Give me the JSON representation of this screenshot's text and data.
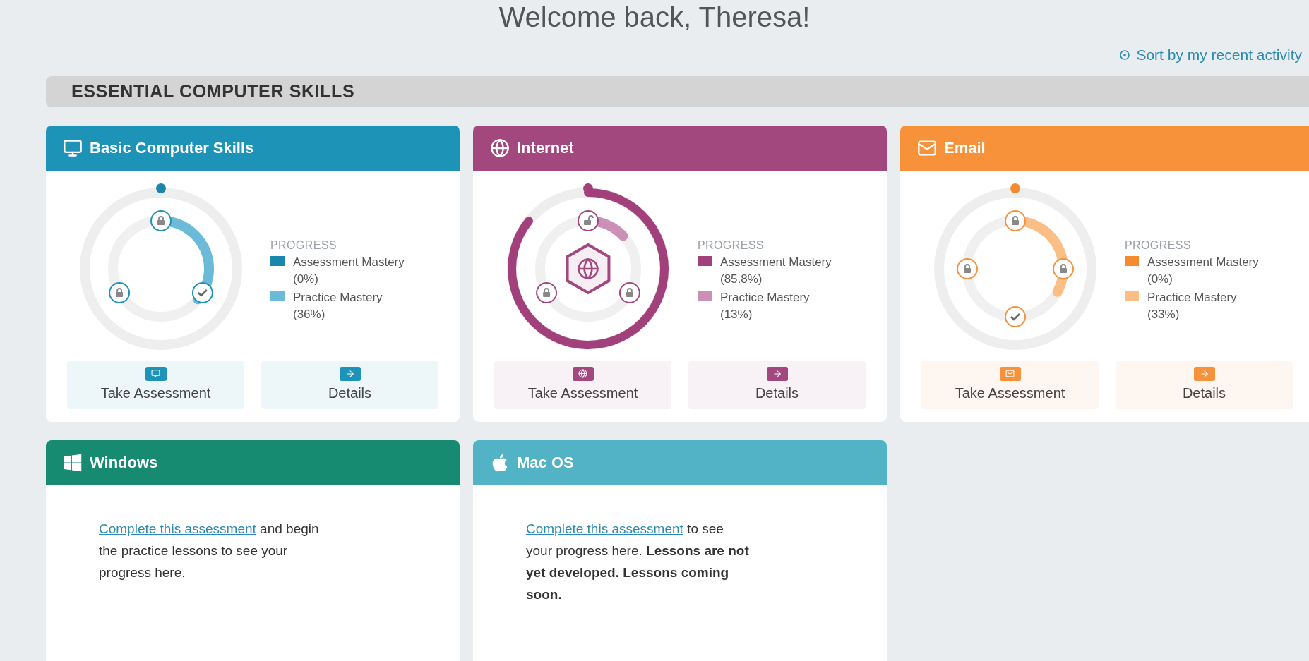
{
  "heading": "Welcome back, Theresa!",
  "sort_link": "Sort by my recent activity",
  "section": {
    "title": "ESSENTIAL COMPUTER SKILLS",
    "cards": [
      {
        "kind": "progress",
        "title": "Basic Computer Skills",
        "color": "#1e93b8",
        "badge": false,
        "legend_title": "PROGRESS",
        "milestones": [
          {
            "locked": true,
            "done": false
          },
          {
            "done": true
          },
          {
            "locked": true,
            "done": false
          }
        ],
        "legend": [
          {
            "label": "Assessment Mastery",
            "reading": "(0%)",
            "color": "#1a86ab"
          },
          {
            "label": "Practice Mastery",
            "reading": "(36%)",
            "color": "#6bbad7"
          }
        ],
        "buttons": [
          "Take Assessment",
          "Details"
        ]
      },
      {
        "kind": "progress",
        "title": "Internet",
        "color": "#a2487f",
        "badge": true,
        "legend_title": "PROGRESS",
        "milestones": [
          {
            "locked": false,
            "done": false
          },
          {
            "locked": true,
            "done": false
          },
          {
            "locked": true,
            "done": false
          }
        ],
        "legend": [
          {
            "label": "Assessment Mastery",
            "reading": "(85.8%)",
            "color": "#a2407c"
          },
          {
            "label": "Practice Mastery",
            "reading": "(13%)",
            "color": "#cc8fb5"
          }
        ],
        "buttons": [
          "Take Assessment",
          "Details"
        ]
      },
      {
        "kind": "progress",
        "title": "Email",
        "color": "#f7923a",
        "badge": false,
        "legend_title": "PROGRESS",
        "milestones": [
          {
            "locked": true,
            "done": false
          },
          {
            "locked": true,
            "done": false
          },
          {
            "done": true
          },
          {
            "locked": true,
            "done": false
          }
        ],
        "legend": [
          {
            "label": "Assessment Mastery",
            "reading": "(0%)",
            "color": "#f58a2e"
          },
          {
            "label": "Practice Mastery",
            "reading": "(33%)",
            "color": "#fbbf85"
          }
        ],
        "buttons": [
          "Take Assessment",
          "Details"
        ]
      },
      {
        "kind": "message",
        "title": "Windows",
        "color": "#178a72",
        "link": "Complete this assessment",
        "text": " and begin the practice lessons to see your progress here."
      },
      {
        "kind": "message",
        "title": "Mac OS",
        "color": "#52b3c7",
        "link": "Complete this assessment",
        "text": " to see your progress here. **Lessons are not yet developed. Lessons coming soon.**"
      }
    ]
  }
}
